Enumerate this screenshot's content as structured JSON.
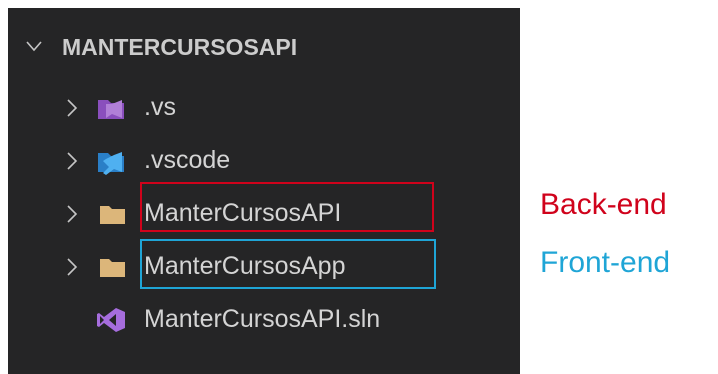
{
  "explorer": {
    "section_title": "MANTERCURSOSAPI",
    "items": [
      {
        "label": ".vs",
        "icon": "visual-studio-folder-icon",
        "expandable": true
      },
      {
        "label": ".vscode",
        "icon": "vscode-folder-icon",
        "expandable": true
      },
      {
        "label": "ManterCursosAPI",
        "icon": "folder-icon",
        "expandable": true
      },
      {
        "label": "ManterCursosApp",
        "icon": "folder-icon",
        "expandable": true
      },
      {
        "label": "ManterCursosAPI.sln",
        "icon": "visual-studio-solution-icon",
        "expandable": false
      }
    ]
  },
  "annotations": {
    "backend": {
      "text": "Back-end",
      "color": "#d0021b"
    },
    "frontend": {
      "text": "Front-end",
      "color": "#1fa5d6"
    }
  },
  "colors": {
    "panel_bg": "#252526",
    "text": "#d4d4d4",
    "folder": "#dcb67a"
  }
}
